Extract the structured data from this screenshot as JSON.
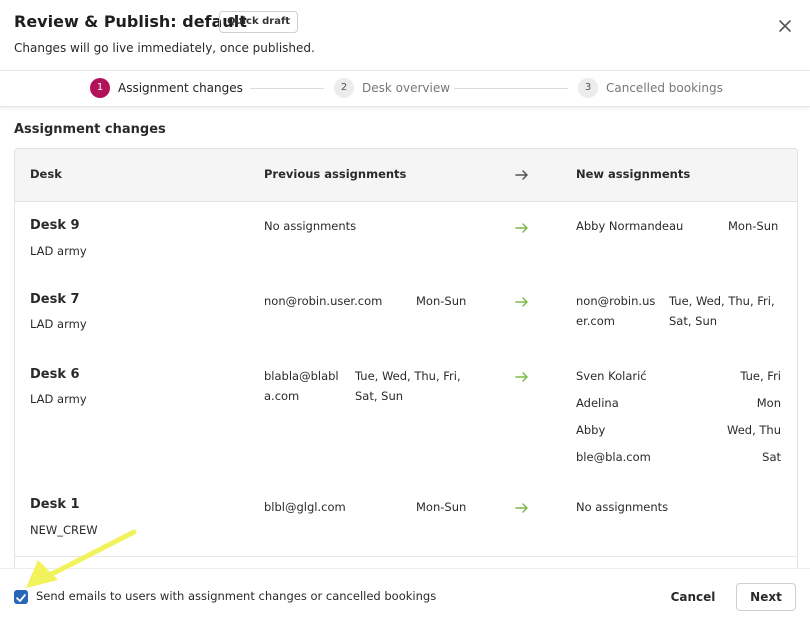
{
  "dialog": {
    "title": "Review & Publish: default",
    "badge": "Quick draft",
    "subtitle": "Changes will go live immediately, once published.",
    "close_icon": "close-icon"
  },
  "stepper": {
    "steps": [
      {
        "number": "1",
        "label": "Assignment changes",
        "active": true
      },
      {
        "number": "2",
        "label": "Desk overview",
        "active": false
      },
      {
        "number": "3",
        "label": "Cancelled bookings",
        "active": false
      }
    ],
    "active_color": "#b2125a"
  },
  "section": {
    "title": "Assignment changes"
  },
  "table": {
    "headers": {
      "desk": "Desk",
      "previous": "Previous assignments",
      "new": "New assignments"
    },
    "rows": [
      {
        "desk": "Desk 9",
        "group": "LAD army",
        "previous": [
          {
            "who": "No assignments",
            "days": ""
          }
        ],
        "new": [
          {
            "who": "Abby Normandeau",
            "days": "Mon-Sun"
          }
        ]
      },
      {
        "desk": "Desk 7",
        "group": "LAD army",
        "previous": [
          {
            "who": "non@robin.user.com",
            "days": "Mon-Sun"
          }
        ],
        "new": [
          {
            "who_line1": "non@robin.us",
            "who_line2": "er.com",
            "days_line1": "Tue, Wed, Thu, Fri,",
            "days_line2": "Sat, Sun"
          }
        ]
      },
      {
        "desk": "Desk 6",
        "group": "LAD army",
        "previous": [
          {
            "who_line1": "blabla@blabl",
            "who_line2": "a.com",
            "days_line1": "Tue, Wed, Thu, Fri,",
            "days_line2": "Sat, Sun"
          }
        ],
        "new": [
          {
            "who": "Sven Kolarić",
            "days": "Tue, Fri"
          },
          {
            "who": "Adelina",
            "days": "Mon"
          },
          {
            "who": "Abby",
            "days": "Wed, Thu"
          },
          {
            "who": "ble@bla.com",
            "days": "Sat"
          }
        ]
      },
      {
        "desk": "Desk 1",
        "group": "NEW_CREW",
        "previous": [
          {
            "who": "blbl@glgl.com",
            "days": "Mon-Sun"
          }
        ],
        "new": [
          {
            "who": "No assignments",
            "days": ""
          }
        ]
      }
    ],
    "arrow_color": "#7dba4a"
  },
  "footer": {
    "checkbox_label": "Send emails to users with assignment changes or cancelled bookings",
    "checkbox_checked": true,
    "cancel_label": "Cancel",
    "next_label": "Next"
  },
  "colors": {
    "checkbox": "#2866b7",
    "highlight_arrow": "#f2f25c"
  }
}
